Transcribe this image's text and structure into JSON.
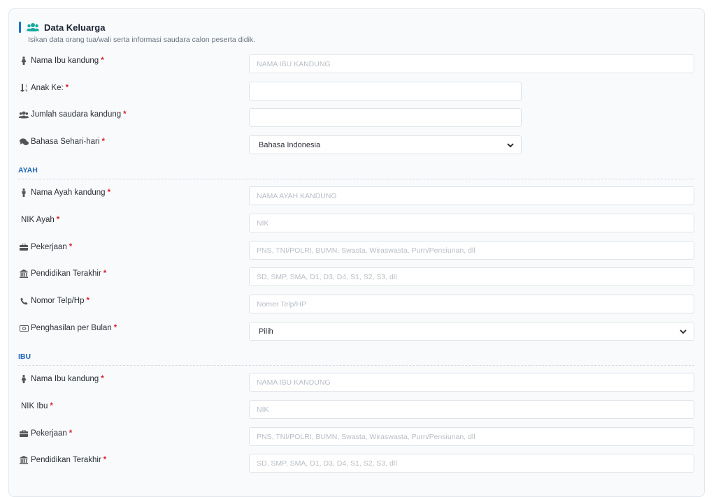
{
  "header": {
    "title": "Data Keluarga",
    "subtitle": "Isikan data orang tua/wali serta informasi saudara calon peserta didik.",
    "accent": "#1a73c8",
    "icon_color": "#14a8a0"
  },
  "general": {
    "ibu_label": "Nama Ibu kandung",
    "ibu_placeholder": "NAMA IBU KANDUNG",
    "anak_label": "Anak Ke:",
    "saudara_label": "Jumlah saudara kandung",
    "bahasa_label": "Bahasa Sehari-hari",
    "bahasa_value": "Bahasa Indonesia"
  },
  "ayah": {
    "section": "AYAH",
    "nama_label": "Nama Ayah kandung",
    "nama_placeholder": "NAMA AYAH KANDUNG",
    "nik_label": "NIK Ayah",
    "nik_placeholder": "NIK",
    "pekerjaan_label": "Pekerjaan",
    "pekerjaan_placeholder": "PNS, TNI/POLRI, BUMN, Swasta, Wiraswasta, Purn/Pensiunan, dll",
    "pendidikan_label": "Pendidikan Terakhir",
    "pendidikan_placeholder": "SD, SMP, SMA, D1, D3, D4, S1, S2, S3, dll",
    "telp_label": "Nomor Telp/Hp",
    "telp_placeholder": "Nomer Telp/HP",
    "penghasilan_label": "Penghasilan per Bulan",
    "penghasilan_value": "Pilih"
  },
  "ibu": {
    "section": "IBU",
    "nama_label": "Nama Ibu kandung",
    "nama_placeholder": "NAMA IBU KANDUNG",
    "nik_label": "NIK Ibu",
    "nik_placeholder": "NIK",
    "pekerjaan_label": "Pekerjaan",
    "pekerjaan_placeholder": "PNS, TNI/POLRI, BUMN, Swasta, Wiraswasta, Purn/Pensiunan, dll",
    "pendidikan_label": "Pendidikan Terakhir",
    "pendidikan_placeholder": "SD, SMP, SMA, D1, D3, D4, S1, S2, S3, dll"
  },
  "required_mark": "*"
}
